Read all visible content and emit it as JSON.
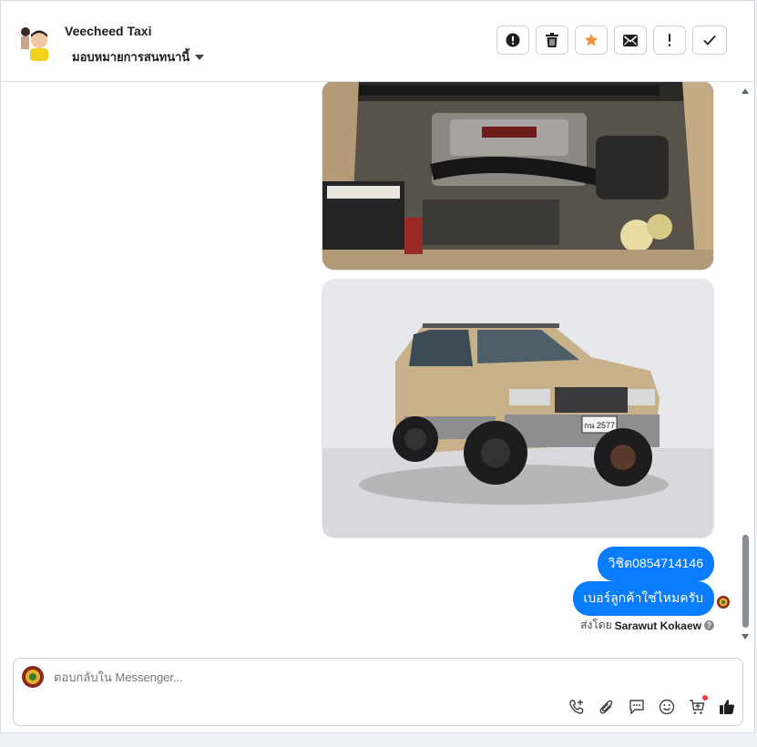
{
  "header": {
    "contact_name": "Veecheed Taxi",
    "assign_label": "มอบหมายการสนทนานี้"
  },
  "toolbar": {
    "buttons": [
      "alert-circle-icon",
      "trash-icon",
      "star-icon",
      "mail-icon",
      "exclamation-icon",
      "check-icon"
    ],
    "star_color": "#f7923b"
  },
  "messages": [
    {
      "type": "image",
      "subject": "engine bay photo"
    },
    {
      "type": "image",
      "subject": "gold SUV photo",
      "plate": "กน 2577"
    },
    {
      "type": "text",
      "text": "วิชิต0854714146"
    },
    {
      "type": "text",
      "text": "เบอร์ลูกค้าใช่ไหมครับ"
    }
  ],
  "sent_by": {
    "prefix": "ส่งโดย",
    "name": "Sarawut Kokaew"
  },
  "composer": {
    "placeholder": "ตอบกลับใน Messenger...",
    "tools": [
      "phone-plus-icon",
      "paperclip-icon",
      "saved-reply-icon",
      "emoji-icon",
      "cart-icon",
      "thumbs-up-icon"
    ]
  },
  "colors": {
    "bubble": "#0a7cff",
    "accent": "#f7923b"
  }
}
